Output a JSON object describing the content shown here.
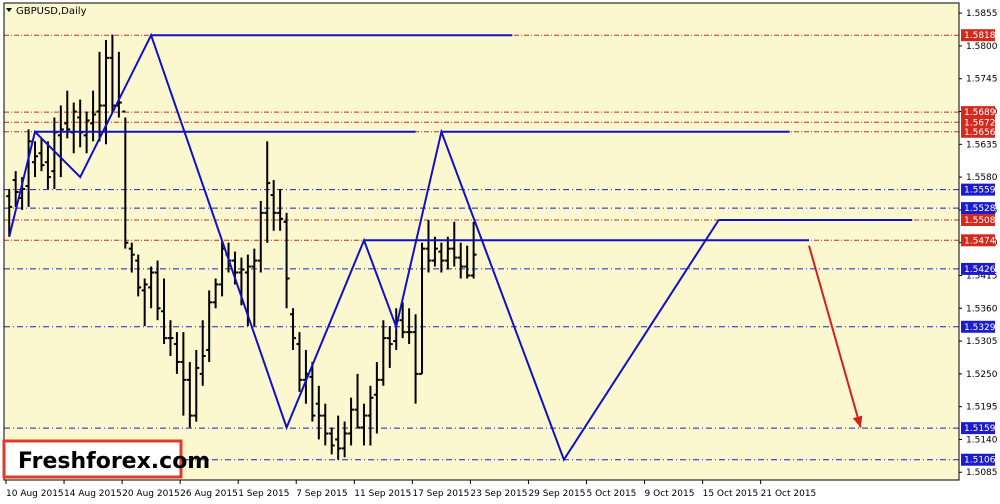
{
  "window": {
    "symbol_label": "GBPUSD,Daily",
    "menu_arrow": "triangle-down-icon"
  },
  "watermark": {
    "text": "Freshforex.com"
  },
  "colors": {
    "background": "#fbf8cf",
    "frame": "#000000",
    "red_level": "#d12b1f",
    "blue_level": "#1c1ccc",
    "pattern": "#1010c8",
    "bars": "#000000",
    "arrow": "#d21f1f",
    "watermark_border": "#e23b2b"
  },
  "chart_data": {
    "type": "ohlc",
    "symbol": "GBPUSD",
    "timeframe": "Daily",
    "ylim": [
      1.5072,
      1.5872
    ],
    "x_tick_labels": [
      "10 Aug 2015",
      "14 Aug 2015",
      "20 Aug 2015",
      "26 Aug 2015",
      "1 Sep 2015",
      "7 Sep 2015",
      "11 Sep 2015",
      "17 Sep 2015",
      "23 Sep 2015",
      "29 Sep 2015",
      "5 Oct 2015",
      "9 Oct 2015",
      "15 Oct 2015",
      "21 Oct 2015"
    ],
    "y_tick_labels": [
      "1.5855",
      "1.5800",
      "1.5745",
      "1.5690",
      "1.5635",
      "1.5580",
      "1.5525",
      "1.5470",
      "1.5415",
      "1.5360",
      "1.5305",
      "1.5250",
      "1.5195",
      "1.5140",
      "1.5085"
    ],
    "levels": [
      {
        "value": 1.5818,
        "label": "1.5818",
        "style": "red"
      },
      {
        "value": 1.5689,
        "label": "1.5689",
        "style": "red"
      },
      {
        "value": 1.5672,
        "label": "1.5672",
        "style": "red"
      },
      {
        "value": 1.5656,
        "label": "1.5656",
        "style": "red"
      },
      {
        "value": 1.5559,
        "label": "1.5559",
        "style": "blue"
      },
      {
        "value": 1.5528,
        "label": "1.5528",
        "style": "blue"
      },
      {
        "value": 1.5508,
        "label": "1.5508",
        "style": "red"
      },
      {
        "value": 1.5474,
        "label": "1.5474",
        "style": "red"
      },
      {
        "value": 1.5426,
        "label": "1.5426",
        "style": "blue"
      },
      {
        "value": 1.5329,
        "label": "1.5329",
        "style": "blue"
      },
      {
        "value": 1.5159,
        "label": "1.5159",
        "style": "blue"
      },
      {
        "value": 1.5106,
        "label": "1.5106",
        "style": "blue"
      }
    ],
    "bars": [
      {
        "high": 1.556,
        "low": 1.548,
        "open": 1.5548,
        "close": 1.553
      },
      {
        "high": 1.559,
        "low": 1.553,
        "open": 1.5575,
        "close": 1.5555
      },
      {
        "high": 1.558,
        "low": 1.5525,
        "open": 1.5545,
        "close": 1.556
      },
      {
        "high": 1.566,
        "low": 1.553,
        "open": 1.5565,
        "close": 1.564
      },
      {
        "high": 1.564,
        "low": 1.558,
        "open": 1.5605,
        "close": 1.5615
      },
      {
        "high": 1.5645,
        "low": 1.559,
        "open": 1.562,
        "close": 1.56
      },
      {
        "high": 1.564,
        "low": 1.556,
        "open": 1.5605,
        "close": 1.558
      },
      {
        "high": 1.568,
        "low": 1.556,
        "open": 1.559,
        "close": 1.5655
      },
      {
        "high": 1.57,
        "low": 1.558,
        "open": 1.565,
        "close": 1.566
      },
      {
        "high": 1.5725,
        "low": 1.5645,
        "open": 1.567,
        "close": 1.566
      },
      {
        "high": 1.5705,
        "low": 1.562,
        "open": 1.5655,
        "close": 1.569
      },
      {
        "high": 1.571,
        "low": 1.563,
        "open": 1.568,
        "close": 1.5655
      },
      {
        "high": 1.569,
        "low": 1.562,
        "open": 1.565,
        "close": 1.5675
      },
      {
        "high": 1.5725,
        "low": 1.564,
        "open": 1.567,
        "close": 1.5685
      },
      {
        "high": 1.579,
        "low": 1.564,
        "open": 1.569,
        "close": 1.57
      },
      {
        "high": 1.581,
        "low": 1.5635,
        "open": 1.57,
        "close": 1.578
      },
      {
        "high": 1.5819,
        "low": 1.569,
        "open": 1.578,
        "close": 1.57
      },
      {
        "high": 1.579,
        "low": 1.568,
        "open": 1.57,
        "close": 1.5705
      },
      {
        "high": 1.568,
        "low": 1.546,
        "open": 1.569,
        "close": 1.547
      },
      {
        "high": 1.547,
        "low": 1.542,
        "open": 1.546,
        "close": 1.545
      },
      {
        "high": 1.545,
        "low": 1.538,
        "open": 1.544,
        "close": 1.5395
      },
      {
        "high": 1.541,
        "low": 1.533,
        "open": 1.539,
        "close": 1.54
      },
      {
        "high": 1.543,
        "low": 1.536,
        "open": 1.5395,
        "close": 1.542
      },
      {
        "high": 1.544,
        "low": 1.534,
        "open": 1.542,
        "close": 1.536
      },
      {
        "high": 1.541,
        "low": 1.53,
        "open": 1.5355,
        "close": 1.531
      },
      {
        "high": 1.534,
        "low": 1.528,
        "open": 1.531,
        "close": 1.531
      },
      {
        "high": 1.532,
        "low": 1.525,
        "open": 1.53,
        "close": 1.527
      },
      {
        "high": 1.532,
        "low": 1.518,
        "open": 1.527,
        "close": 1.524
      },
      {
        "high": 1.527,
        "low": 1.516,
        "open": 1.524,
        "close": 1.518
      },
      {
        "high": 1.529,
        "low": 1.517,
        "open": 1.518,
        "close": 1.526
      },
      {
        "high": 1.534,
        "low": 1.523,
        "open": 1.525,
        "close": 1.528
      },
      {
        "high": 1.539,
        "low": 1.527,
        "open": 1.529,
        "close": 1.537
      },
      {
        "high": 1.541,
        "low": 1.536,
        "open": 1.537,
        "close": 1.54
      },
      {
        "high": 1.5474,
        "low": 1.538,
        "open": 1.54,
        "close": 1.546
      },
      {
        "high": 1.547,
        "low": 1.542,
        "open": 1.545,
        "close": 1.544
      },
      {
        "high": 1.5455,
        "low": 1.54,
        "open": 1.544,
        "close": 1.542
      },
      {
        "high": 1.5445,
        "low": 1.5365,
        "open": 1.542,
        "close": 1.5425
      },
      {
        "high": 1.545,
        "low": 1.533,
        "open": 1.542,
        "close": 1.543
      },
      {
        "high": 1.546,
        "low": 1.533,
        "open": 1.543,
        "close": 1.544
      },
      {
        "high": 1.554,
        "low": 1.542,
        "open": 1.544,
        "close": 1.552
      },
      {
        "high": 1.564,
        "low": 1.547,
        "open": 1.552,
        "close": 1.557
      },
      {
        "high": 1.5575,
        "low": 1.549,
        "open": 1.555,
        "close": 1.552
      },
      {
        "high": 1.556,
        "low": 1.549,
        "open": 1.552,
        "close": 1.551
      },
      {
        "high": 1.552,
        "low": 1.536,
        "open": 1.5505,
        "close": 1.541
      },
      {
        "high": 1.536,
        "low": 1.529,
        "open": 1.535,
        "close": 1.531
      },
      {
        "high": 1.532,
        "low": 1.522,
        "open": 1.53,
        "close": 1.524
      },
      {
        "high": 1.529,
        "low": 1.52,
        "open": 1.524,
        "close": 1.525
      },
      {
        "high": 1.527,
        "low": 1.517,
        "open": 1.5245,
        "close": 1.518
      },
      {
        "high": 1.523,
        "low": 1.514,
        "open": 1.52,
        "close": 1.518
      },
      {
        "high": 1.52,
        "low": 1.513,
        "open": 1.518,
        "close": 1.515
      },
      {
        "high": 1.516,
        "low": 1.5115,
        "open": 1.515,
        "close": 1.513
      },
      {
        "high": 1.518,
        "low": 1.5106,
        "open": 1.514,
        "close": 1.5125
      },
      {
        "high": 1.517,
        "low": 1.511,
        "open": 1.5125,
        "close": 1.515
      },
      {
        "high": 1.521,
        "low": 1.513,
        "open": 1.515,
        "close": 1.519
      },
      {
        "high": 1.525,
        "low": 1.516,
        "open": 1.519,
        "close": 1.516
      },
      {
        "high": 1.52,
        "low": 1.513,
        "open": 1.516,
        "close": 1.518
      },
      {
        "high": 1.523,
        "low": 1.513,
        "open": 1.518,
        "close": 1.521
      },
      {
        "high": 1.527,
        "low": 1.515,
        "open": 1.5215,
        "close": 1.524
      },
      {
        "high": 1.534,
        "low": 1.523,
        "open": 1.524,
        "close": 1.531
      },
      {
        "high": 1.533,
        "low": 1.526,
        "open": 1.531,
        "close": 1.53
      },
      {
        "high": 1.536,
        "low": 1.529,
        "open": 1.5305,
        "close": 1.534
      },
      {
        "high": 1.537,
        "low": 1.531,
        "open": 1.534,
        "close": 1.532
      },
      {
        "high": 1.536,
        "low": 1.53,
        "open": 1.532,
        "close": 1.532
      },
      {
        "high": 1.535,
        "low": 1.52,
        "open": 1.532,
        "close": 1.525
      },
      {
        "high": 1.547,
        "low": 1.525,
        "open": 1.525,
        "close": 1.546
      },
      {
        "high": 1.5508,
        "low": 1.542,
        "open": 1.546,
        "close": 1.544
      },
      {
        "high": 1.548,
        "low": 1.543,
        "open": 1.544,
        "close": 1.546
      },
      {
        "high": 1.547,
        "low": 1.542,
        "open": 1.5455,
        "close": 1.544
      },
      {
        "high": 1.548,
        "low": 1.5425,
        "open": 1.544,
        "close": 1.546
      },
      {
        "high": 1.5505,
        "low": 1.543,
        "open": 1.546,
        "close": 1.5445
      },
      {
        "high": 1.547,
        "low": 1.541,
        "open": 1.5445,
        "close": 1.543
      },
      {
        "high": 1.5465,
        "low": 1.541,
        "open": 1.543,
        "close": 1.5415
      },
      {
        "high": 1.5505,
        "low": 1.541,
        "open": 1.5415,
        "close": 1.545
      }
    ],
    "pattern_line": [
      {
        "bar": 0,
        "price": 1.548
      },
      {
        "bar": 4,
        "price": 1.5656
      },
      {
        "bar": 11,
        "price": 1.558
      },
      {
        "bar": 22,
        "price": 1.5818
      },
      {
        "bar": 43,
        "price": 1.516
      },
      {
        "bar": 55,
        "price": 1.5474
      },
      {
        "bar": 60,
        "price": 1.5329
      },
      {
        "bar": 67,
        "price": 1.5656
      },
      {
        "bar": 86,
        "price": 1.5106
      },
      {
        "bar": 110,
        "price": 1.5508
      }
    ],
    "resistance_segments": [
      {
        "from_bar": 22,
        "to_bar": 78,
        "price": 1.5818
      },
      {
        "from_bar": 4,
        "to_bar": 63,
        "price": 1.5656
      },
      {
        "from_bar": 67,
        "to_bar": 121,
        "price": 1.5656
      },
      {
        "from_bar": 110,
        "to_bar": 140,
        "price": 1.5508
      },
      {
        "from_bar": 55,
        "to_bar": 124,
        "price": 1.5474
      }
    ],
    "forecast_arrow": {
      "from_bar": 124,
      "from_price": 1.5465,
      "to_bar": 132,
      "to_price": 1.516
    }
  }
}
